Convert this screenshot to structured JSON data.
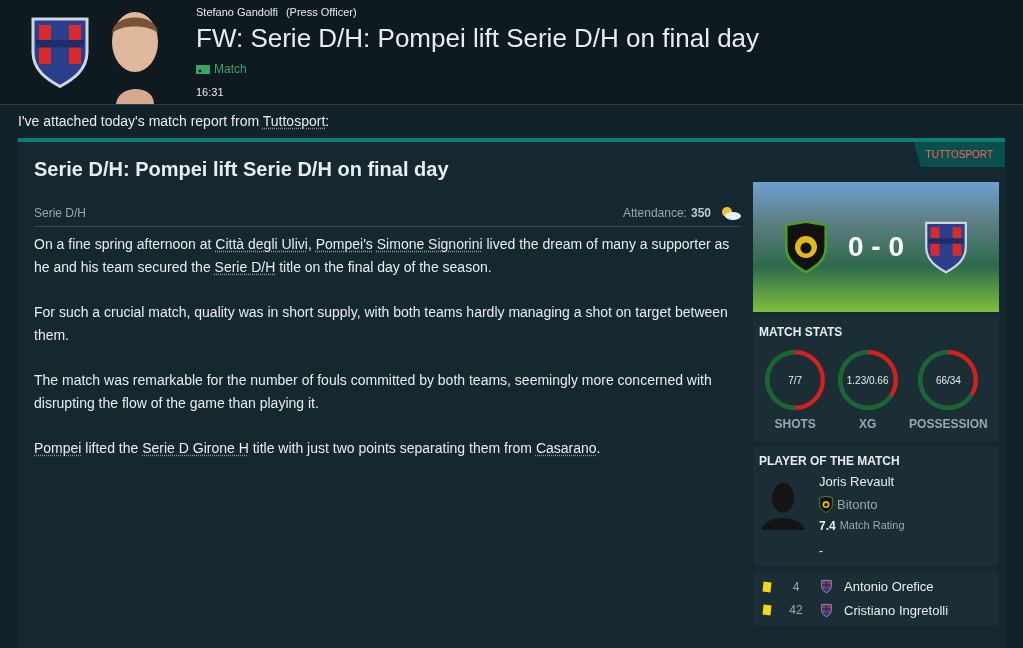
{
  "message": {
    "sender": "Stefano Gandolfi",
    "role": "(Press Officer)",
    "subject": "FW: Serie D/H: Pompei lift Serie D/H on final day",
    "tag": "Match",
    "time": "16:31"
  },
  "intro": [
    {
      "text": "I've attached today's match report from ",
      "link": false
    },
    {
      "text": "Tuttosport",
      "link": true
    },
    {
      "text": ":",
      "link": false
    }
  ],
  "article": {
    "source": "TUTTOSPORT",
    "headline": "Serie D/H: Pompei lift Serie D/H on final day",
    "competition": "Serie D/H",
    "attendance_label": "Attendance:",
    "attendance": "350",
    "paragraphs": [
      [
        {
          "text": "On a fine spring afternoon at ",
          "link": false
        },
        {
          "text": "Città degli Ulivi",
          "link": true
        },
        {
          "text": ", ",
          "link": false
        },
        {
          "text": "Pompei's",
          "link": true,
          "space_after": true
        },
        {
          "text": "Simone Signorini",
          "link": true
        },
        {
          "text": " lived the dream of many a supporter as he and his team secured the ",
          "link": false
        },
        {
          "text": "Serie D/H",
          "link": true
        },
        {
          "text": " title on the final day of the season.",
          "link": false
        }
      ],
      [
        {
          "text": "For such a crucial match, quality was in short supply, with both teams hardly managing a shot on target between them.",
          "link": false
        }
      ],
      [
        {
          "text": "The match was remarkable for the number of fouls committed by both teams, seemingly more concerned with disrupting the flow of the game than playing it.",
          "link": false
        }
      ],
      [
        {
          "text": "Pompei",
          "link": true
        },
        {
          "text": " lifted the ",
          "link": false
        },
        {
          "text": "Serie D Girone H",
          "link": true
        },
        {
          "text": " title with just two points separating them from ",
          "link": false
        },
        {
          "text": "Casarano",
          "link": true
        },
        {
          "text": ".",
          "link": false
        }
      ]
    ]
  },
  "score": "0 - 0",
  "match_stats": {
    "title": "MATCH STATS",
    "stats": [
      {
        "value": "7/7",
        "label": "SHOTS",
        "level": 0.5
      },
      {
        "value": "1.23/0.66",
        "label": "XG",
        "level": 0.65
      },
      {
        "value": "66/34",
        "label": "POSSESSION",
        "level": 0.66
      }
    ]
  },
  "player_of_match": {
    "title": "PLAYER OF THE MATCH",
    "name": "Joris Revault",
    "club": "Bitonto",
    "rating": "7.4",
    "rating_label": "Match Rating",
    "note": "-"
  },
  "events": [
    {
      "kind": "yellow_card",
      "minute": "4",
      "player": "Antonio Orefice"
    },
    {
      "kind": "yellow_card",
      "minute": "42",
      "player": "Cristiano Ingretolli"
    }
  ]
}
